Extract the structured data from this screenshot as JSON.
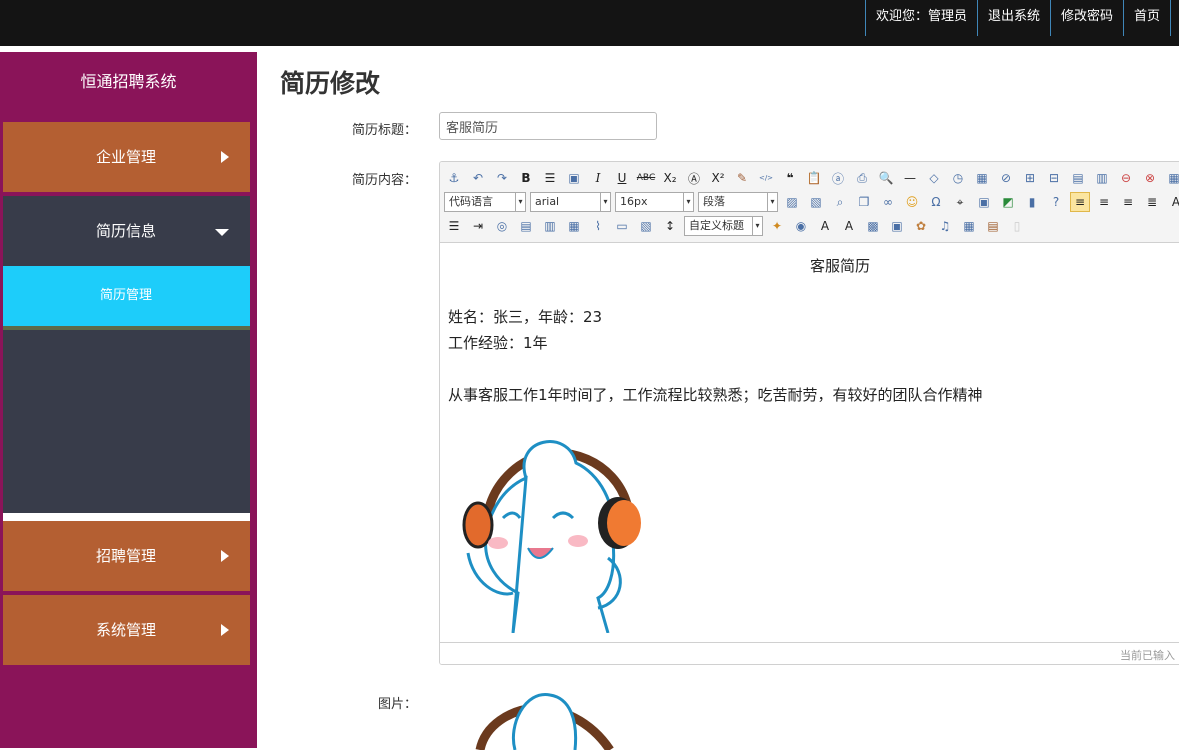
{
  "topnav": {
    "welcome": "欢迎您：管理员",
    "logout": "退出系统",
    "change_password": "修改密码",
    "home": "首页"
  },
  "sidebar": {
    "brand": "恒通招聘系统",
    "items": [
      {
        "label": "企业管理"
      },
      {
        "label": "简历信息",
        "expanded": true,
        "children": [
          {
            "label": "简历管理",
            "active": true
          }
        ]
      },
      {
        "label": "招聘管理"
      },
      {
        "label": "系统管理"
      }
    ]
  },
  "colors": {
    "sidebar_bg": "#8a1459",
    "menu_item_bg": "#b45f32",
    "submenu_bg": "#383c4a",
    "active_bg": "#1dcdfa",
    "topbar_bg": "#141414"
  },
  "main": {
    "title": "简历修改",
    "form": {
      "title_label": "简历标题：",
      "title_value": "客服简历",
      "content_label": "简历内容：",
      "image_label": "图片："
    }
  },
  "editor": {
    "toolbar": {
      "code_language": "代码语言",
      "font_family": "arial",
      "font_size": "16px",
      "paragraph": "段落",
      "custom_heading": "自定义标题"
    },
    "content": {
      "heading": "客服简历",
      "line1": "姓名：张三，年龄：23",
      "line2": "工作经验：1年",
      "line3": "从事客服工作1年时间了，工作流程比较熟悉；吃苦耐劳，有较好的团队合作精神"
    },
    "status": "当前已输入"
  }
}
